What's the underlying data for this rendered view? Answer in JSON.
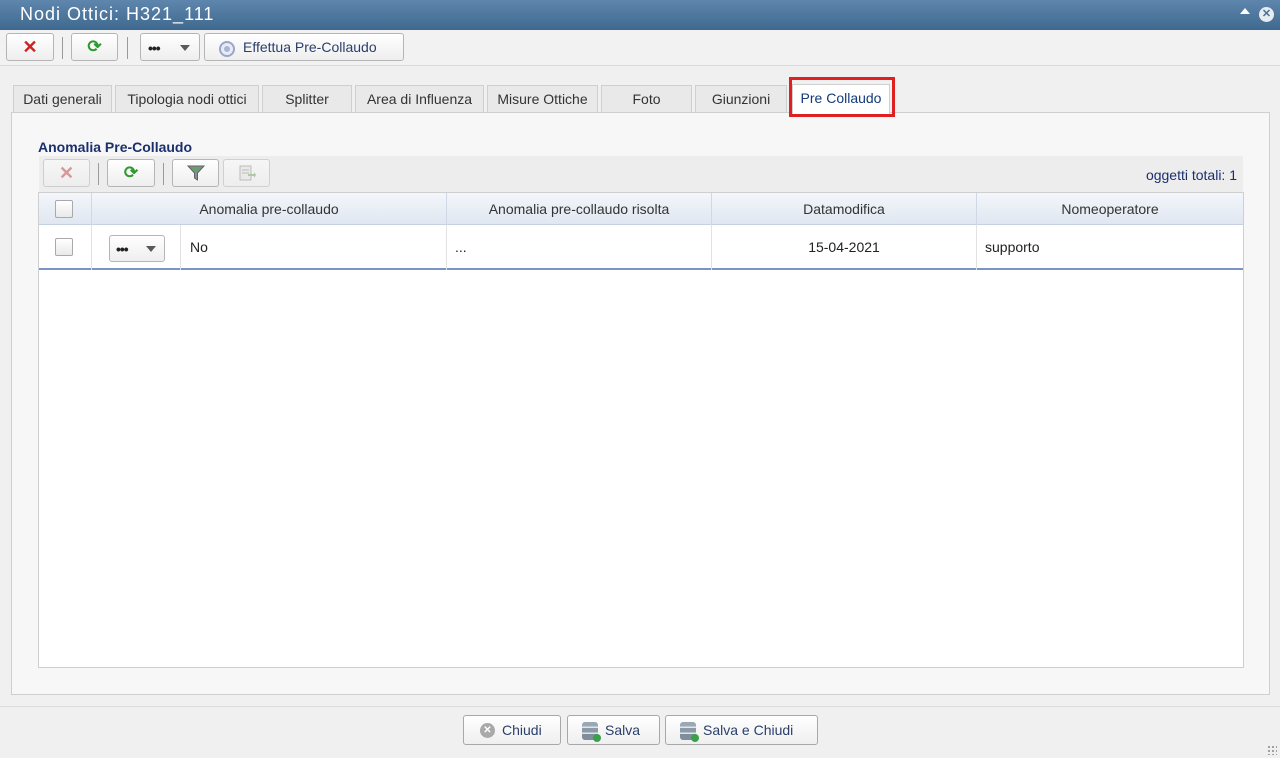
{
  "window": {
    "title": "Nodi Ottici: H321_111"
  },
  "toolbar": {
    "delete_icon": "delete-icon",
    "refresh_icon": "refresh-icon",
    "more_label": "•••",
    "precollaudo_label": "Effettua Pre-Collaudo"
  },
  "tabs": [
    {
      "label": "Dati generali",
      "active": false
    },
    {
      "label": "Tipologia nodi ottici",
      "active": false
    },
    {
      "label": "Splitter",
      "active": false
    },
    {
      "label": "Area di Influenza",
      "active": false
    },
    {
      "label": "Misure Ottiche",
      "active": false
    },
    {
      "label": "Foto",
      "active": false
    },
    {
      "label": "Giunzioni",
      "active": false
    },
    {
      "label": "Pre Collaudo",
      "active": true
    }
  ],
  "section": {
    "title": "Anomalia Pre-Collaudo",
    "total_label": "oggetti totali: 1"
  },
  "grid": {
    "columns": [
      "Anomalia pre-collaudo",
      "Anomalia pre-collaudo risolta",
      "Datamodifica",
      "Nomeoperatore"
    ],
    "rows": [
      {
        "actions_label": "•••",
        "anomalia": "No",
        "risolta": "...",
        "datamodifica": "15-04-2021",
        "operatore": "supporto"
      }
    ]
  },
  "footer": {
    "close_label": "Chiudi",
    "save_label": "Salva",
    "save_close_label": "Salva e Chiudi"
  },
  "colors": {
    "titlebar": "#4a74a0",
    "highlight": "#e02020",
    "link_text": "#1a2f6e"
  }
}
